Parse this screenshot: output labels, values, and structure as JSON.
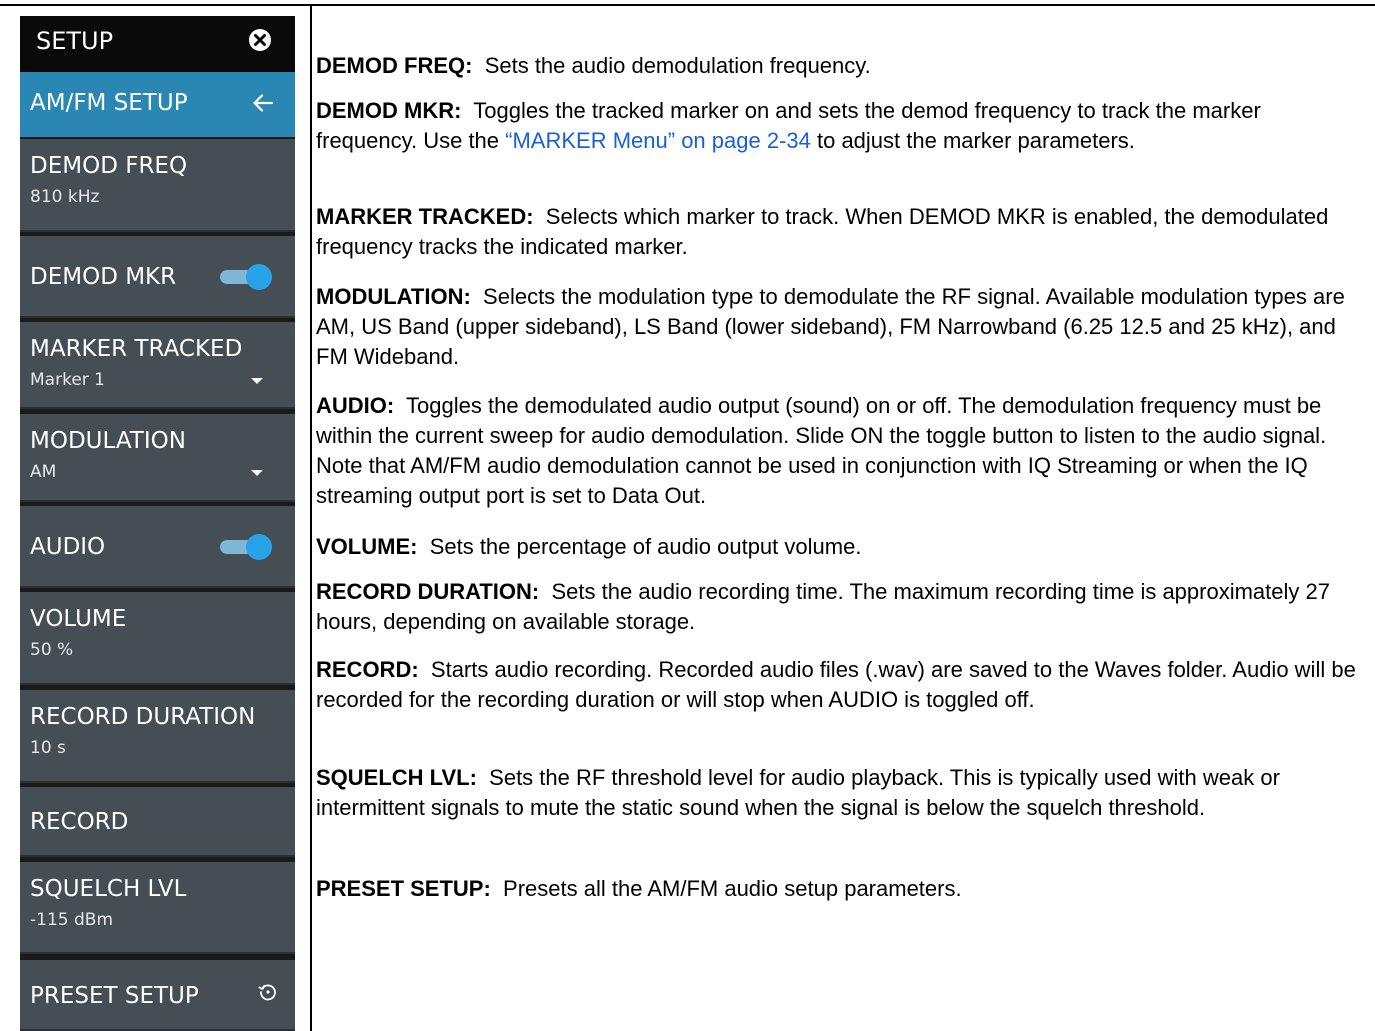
{
  "menu": {
    "title": "SETUP",
    "submenu_title": "AM/FM SETUP",
    "buttons": {
      "demod_freq": {
        "label": "DEMOD FREQ",
        "value": "810 kHz"
      },
      "demod_mkr": {
        "label": "DEMOD MKR",
        "toggle": "on"
      },
      "marker_tracked": {
        "label": "MARKER TRACKED",
        "value": "Marker 1"
      },
      "modulation": {
        "label": "MODULATION",
        "value": "AM"
      },
      "audio": {
        "label": "AUDIO",
        "toggle": "on"
      },
      "volume": {
        "label": "VOLUME",
        "value": "50 %"
      },
      "record_duration": {
        "label": "RECORD DURATION",
        "value": "10 s"
      },
      "record": {
        "label": "RECORD"
      },
      "squelch_lvl": {
        "label": "SQUELCH LVL",
        "value": "-115 dBm"
      },
      "preset_setup": {
        "label": "PRESET SETUP"
      }
    },
    "colors": {
      "header_bg": "#0a0a0a",
      "submenu_bg": "#2a87b3",
      "button_bg": "#454d55",
      "toggle_knob": "#29a3e8",
      "toggle_track": "#7fb6d6",
      "link": "#1a5fd6"
    },
    "icons": [
      "close-icon",
      "back-arrow-icon",
      "dropdown-icon",
      "reset-icon"
    ]
  },
  "descriptions": {
    "demod_freq": {
      "term": "DEMOD FREQ:",
      "text": "Sets the audio demodulation frequency."
    },
    "demod_mkr": {
      "term": "DEMOD MKR:",
      "text_before": "Toggles the tracked marker on and sets the demod frequency to track the marker frequency. Use the",
      "link": "“MARKER Menu” on page 2-34",
      "text_after": "to adjust the marker parameters."
    },
    "marker_tracked": {
      "term": "MARKER TRACKED:",
      "text": "Selects which marker to track. When DEMOD MKR is enabled, the demodulated frequency tracks the indicated marker."
    },
    "modulation": {
      "term": "MODULATION:",
      "text": "Selects the modulation type to demodulate the RF signal. Available modulation types are AM, US Band (upper sideband), LS Band (lower sideband), FM Narrowband (6.25 12.5 and 25 kHz), and FM Wideband."
    },
    "audio": {
      "term": "AUDIO:",
      "text": "Toggles the demodulated audio output (sound) on or off. The demodulation frequency must be within the current sweep for audio demodulation. Slide ON the toggle button to listen to the audio signal. Note that AM/FM audio demodulation cannot be used in conjunction with IQ Streaming or when the IQ streaming output port is set to Data Out."
    },
    "volume": {
      "term": "VOLUME:",
      "text": "Sets the percentage of audio output volume."
    },
    "record_duration": {
      "term": "RECORD DURATION:",
      "text": "Sets the audio recording time. The maximum recording time is approximately 27 hours, depending on available storage."
    },
    "record": {
      "term": "RECORD:",
      "text": "Starts audio recording. Recorded audio files (.wav) are saved to the Waves folder. Audio will be recorded for the recording duration or will stop when AUDIO is toggled off."
    },
    "squelch_lvl": {
      "term": "SQUELCH LVL:",
      "text": "Sets the RF threshold level for audio playback. This is typically used with weak or intermittent signals to mute the static sound when the signal is below the squelch threshold."
    },
    "preset_setup": {
      "term": "PRESET SETUP:",
      "text": "Presets all the AM/FM audio setup parameters."
    }
  }
}
